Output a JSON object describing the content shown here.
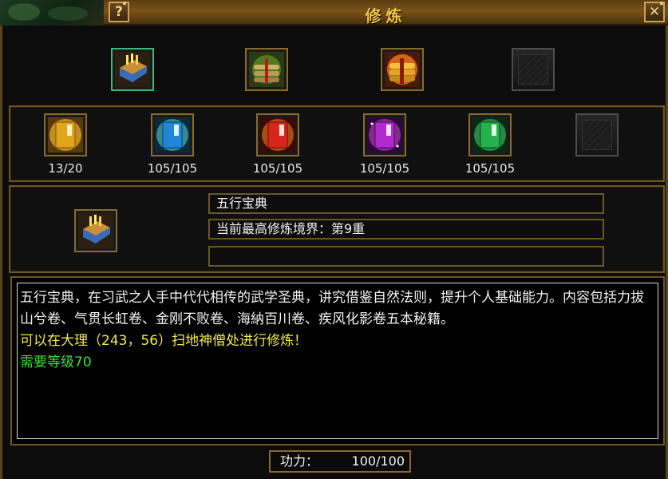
{
  "window": {
    "title": "修炼",
    "help_label": "?",
    "close_label": "✕"
  },
  "top_row": [
    {
      "icon": "five-elements-book-icon",
      "selected": true
    },
    {
      "icon": "bamboo-scroll-bundle-icon",
      "selected": false
    },
    {
      "icon": "golden-scroll-bundle-icon",
      "selected": false
    },
    {
      "icon": "empty-slot-icon",
      "selected": false
    }
  ],
  "chapters": [
    {
      "icon": "yellow-manual-icon",
      "count": "13/20",
      "color": "#e0a51c"
    },
    {
      "icon": "blue-manual-icon",
      "count": "105/105",
      "color": "#1f86d8"
    },
    {
      "icon": "red-manual-icon",
      "count": "105/105",
      "color": "#d8241c"
    },
    {
      "icon": "purple-manual-icon",
      "count": "105/105",
      "color": "#b02ad0"
    },
    {
      "icon": "green-manual-icon",
      "count": "105/105",
      "color": "#23b24c"
    },
    {
      "icon": "empty-slot-icon",
      "count": ""
    }
  ],
  "detail": {
    "icon": "five-elements-book-icon",
    "name": "五行宝典",
    "realm": "当前最高修炼境界：第9重",
    "extra": ""
  },
  "description": {
    "text": "五行宝典，在习武之人手中代代相传的武学圣典，讲究借鉴自然法则，提升个人基础能力。内容包括力拔山兮卷、气贯长虹卷、金刚不败卷、海納百川卷、疾风化影卷五本秘籍。",
    "location": "可以在大理（243，56）扫地神僧处进行修炼！",
    "requirement": "需要等级70"
  },
  "power": {
    "label": "功力：",
    "value": "100/100"
  }
}
